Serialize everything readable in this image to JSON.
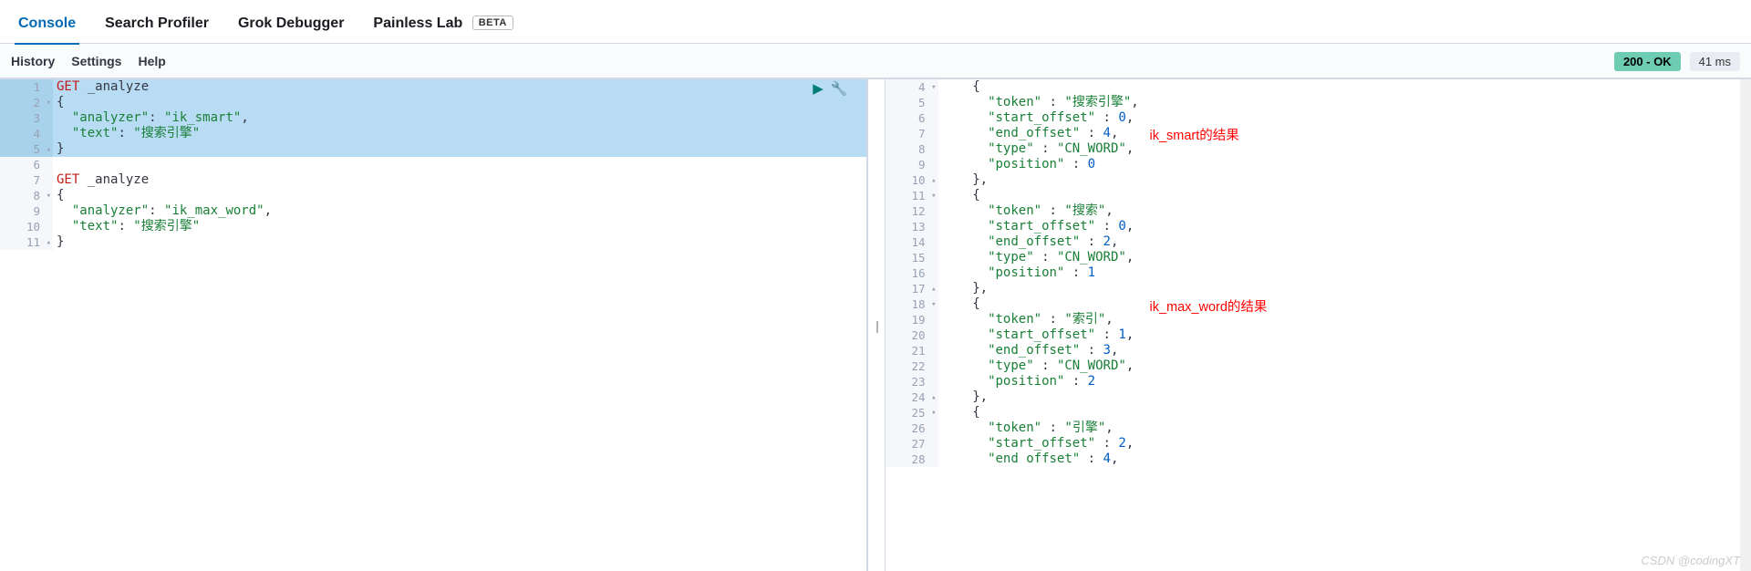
{
  "tabs": {
    "console": "Console",
    "profiler": "Search Profiler",
    "grok": "Grok Debugger",
    "painless": "Painless Lab",
    "beta": "BETA"
  },
  "subbar": {
    "history": "History",
    "settings": "Settings",
    "help": "Help"
  },
  "status": {
    "ok": "200 - OK",
    "time": "41 ms"
  },
  "left_lines": [
    {
      "n": "1",
      "fold": "",
      "hl": true,
      "parts": [
        [
          "kw",
          "GET"
        ],
        [
          "txt",
          " _analyze"
        ]
      ]
    },
    {
      "n": "2",
      "fold": "▾",
      "hl": true,
      "parts": [
        [
          "txt",
          "{"
        ]
      ]
    },
    {
      "n": "3",
      "fold": "",
      "hl": true,
      "parts": [
        [
          "txt",
          "  "
        ],
        [
          "key",
          "\"analyzer\""
        ],
        [
          "txt",
          ": "
        ],
        [
          "str",
          "\"ik_smart\""
        ],
        [
          "txt",
          ","
        ]
      ]
    },
    {
      "n": "4",
      "fold": "",
      "hl": true,
      "parts": [
        [
          "txt",
          "  "
        ],
        [
          "key",
          "\"text\""
        ],
        [
          "txt",
          ": "
        ],
        [
          "str",
          "\"搜索引擎\""
        ]
      ]
    },
    {
      "n": "5",
      "fold": "▴",
      "hl": true,
      "parts": [
        [
          "txt",
          "}"
        ]
      ]
    },
    {
      "n": "6",
      "fold": "",
      "hl": false,
      "parts": [
        [
          "txt",
          ""
        ]
      ]
    },
    {
      "n": "7",
      "fold": "",
      "hl": false,
      "parts": [
        [
          "kw",
          "GET"
        ],
        [
          "txt",
          " _analyze"
        ]
      ]
    },
    {
      "n": "8",
      "fold": "▾",
      "hl": false,
      "parts": [
        [
          "txt",
          "{"
        ]
      ]
    },
    {
      "n": "9",
      "fold": "",
      "hl": false,
      "parts": [
        [
          "txt",
          "  "
        ],
        [
          "key",
          "\"analyzer\""
        ],
        [
          "txt",
          ": "
        ],
        [
          "str",
          "\"ik_max_word\""
        ],
        [
          "txt",
          ","
        ]
      ]
    },
    {
      "n": "10",
      "fold": "",
      "hl": false,
      "parts": [
        [
          "txt",
          "  "
        ],
        [
          "key",
          "\"text\""
        ],
        [
          "txt",
          ": "
        ],
        [
          "str",
          "\"搜索引擎\""
        ]
      ]
    },
    {
      "n": "11",
      "fold": "▴",
      "hl": false,
      "parts": [
        [
          "txt",
          "}"
        ]
      ]
    }
  ],
  "right_lines": [
    {
      "n": "4",
      "fold": "▾",
      "parts": [
        [
          "txt",
          "    {"
        ]
      ]
    },
    {
      "n": "5",
      "fold": "",
      "parts": [
        [
          "txt",
          "      "
        ],
        [
          "key",
          "\"token\""
        ],
        [
          "txt",
          " : "
        ],
        [
          "str",
          "\"搜索引擎\""
        ],
        [
          "txt",
          ","
        ]
      ]
    },
    {
      "n": "6",
      "fold": "",
      "parts": [
        [
          "txt",
          "      "
        ],
        [
          "key",
          "\"start_offset\""
        ],
        [
          "txt",
          " : "
        ],
        [
          "num",
          "0"
        ],
        [
          "txt",
          ","
        ]
      ]
    },
    {
      "n": "7",
      "fold": "",
      "parts": [
        [
          "txt",
          "      "
        ],
        [
          "key",
          "\"end_offset\""
        ],
        [
          "txt",
          " : "
        ],
        [
          "num",
          "4"
        ],
        [
          "txt",
          ","
        ]
      ]
    },
    {
      "n": "8",
      "fold": "",
      "parts": [
        [
          "txt",
          "      "
        ],
        [
          "key",
          "\"type\""
        ],
        [
          "txt",
          " : "
        ],
        [
          "str",
          "\"CN_WORD\""
        ],
        [
          "txt",
          ","
        ]
      ]
    },
    {
      "n": "9",
      "fold": "",
      "parts": [
        [
          "txt",
          "      "
        ],
        [
          "key",
          "\"position\""
        ],
        [
          "txt",
          " : "
        ],
        [
          "num",
          "0"
        ]
      ]
    },
    {
      "n": "10",
      "fold": "▴",
      "parts": [
        [
          "txt",
          "    },"
        ]
      ]
    },
    {
      "n": "11",
      "fold": "▾",
      "parts": [
        [
          "txt",
          "    {"
        ]
      ]
    },
    {
      "n": "12",
      "fold": "",
      "parts": [
        [
          "txt",
          "      "
        ],
        [
          "key",
          "\"token\""
        ],
        [
          "txt",
          " : "
        ],
        [
          "str",
          "\"搜索\""
        ],
        [
          "txt",
          ","
        ]
      ]
    },
    {
      "n": "13",
      "fold": "",
      "parts": [
        [
          "txt",
          "      "
        ],
        [
          "key",
          "\"start_offset\""
        ],
        [
          "txt",
          " : "
        ],
        [
          "num",
          "0"
        ],
        [
          "txt",
          ","
        ]
      ]
    },
    {
      "n": "14",
      "fold": "",
      "parts": [
        [
          "txt",
          "      "
        ],
        [
          "key",
          "\"end_offset\""
        ],
        [
          "txt",
          " : "
        ],
        [
          "num",
          "2"
        ],
        [
          "txt",
          ","
        ]
      ]
    },
    {
      "n": "15",
      "fold": "",
      "parts": [
        [
          "txt",
          "      "
        ],
        [
          "key",
          "\"type\""
        ],
        [
          "txt",
          " : "
        ],
        [
          "str",
          "\"CN_WORD\""
        ],
        [
          "txt",
          ","
        ]
      ]
    },
    {
      "n": "16",
      "fold": "",
      "parts": [
        [
          "txt",
          "      "
        ],
        [
          "key",
          "\"position\""
        ],
        [
          "txt",
          " : "
        ],
        [
          "num",
          "1"
        ]
      ]
    },
    {
      "n": "17",
      "fold": "▴",
      "parts": [
        [
          "txt",
          "    },"
        ]
      ]
    },
    {
      "n": "18",
      "fold": "▾",
      "parts": [
        [
          "txt",
          "    {"
        ]
      ]
    },
    {
      "n": "19",
      "fold": "",
      "parts": [
        [
          "txt",
          "      "
        ],
        [
          "key",
          "\"token\""
        ],
        [
          "txt",
          " : "
        ],
        [
          "str",
          "\"索引\""
        ],
        [
          "txt",
          ","
        ]
      ]
    },
    {
      "n": "20",
      "fold": "",
      "parts": [
        [
          "txt",
          "      "
        ],
        [
          "key",
          "\"start_offset\""
        ],
        [
          "txt",
          " : "
        ],
        [
          "num",
          "1"
        ],
        [
          "txt",
          ","
        ]
      ]
    },
    {
      "n": "21",
      "fold": "",
      "parts": [
        [
          "txt",
          "      "
        ],
        [
          "key",
          "\"end_offset\""
        ],
        [
          "txt",
          " : "
        ],
        [
          "num",
          "3"
        ],
        [
          "txt",
          ","
        ]
      ]
    },
    {
      "n": "22",
      "fold": "",
      "parts": [
        [
          "txt",
          "      "
        ],
        [
          "key",
          "\"type\""
        ],
        [
          "txt",
          " : "
        ],
        [
          "str",
          "\"CN_WORD\""
        ],
        [
          "txt",
          ","
        ]
      ]
    },
    {
      "n": "23",
      "fold": "",
      "parts": [
        [
          "txt",
          "      "
        ],
        [
          "key",
          "\"position\""
        ],
        [
          "txt",
          " : "
        ],
        [
          "num",
          "2"
        ]
      ]
    },
    {
      "n": "24",
      "fold": "▴",
      "parts": [
        [
          "txt",
          "    },"
        ]
      ]
    },
    {
      "n": "25",
      "fold": "▾",
      "parts": [
        [
          "txt",
          "    {"
        ]
      ]
    },
    {
      "n": "26",
      "fold": "",
      "parts": [
        [
          "txt",
          "      "
        ],
        [
          "key",
          "\"token\""
        ],
        [
          "txt",
          " : "
        ],
        [
          "str",
          "\"引擎\""
        ],
        [
          "txt",
          ","
        ]
      ]
    },
    {
      "n": "27",
      "fold": "",
      "parts": [
        [
          "txt",
          "      "
        ],
        [
          "key",
          "\"start_offset\""
        ],
        [
          "txt",
          " : "
        ],
        [
          "num",
          "2"
        ],
        [
          "txt",
          ","
        ]
      ]
    },
    {
      "n": "28",
      "fold": "",
      "parts": [
        [
          "txt",
          "      "
        ],
        [
          "key",
          "\"end offset\""
        ],
        [
          "txt",
          " : "
        ],
        [
          "num",
          "4"
        ],
        [
          "txt",
          ","
        ]
      ]
    }
  ],
  "annotations": {
    "a1": "ik_smart的结果",
    "a2": "ik_max_word的结果"
  },
  "watermark": "CSDN @codingXT"
}
